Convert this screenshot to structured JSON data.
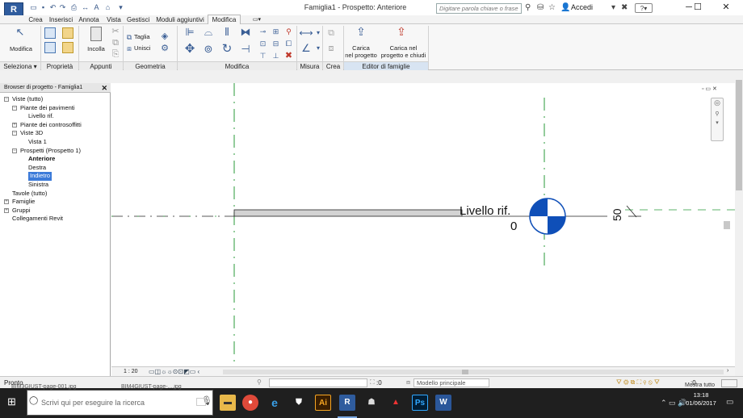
{
  "app": {
    "logo": "R",
    "title": "Famiglia1 - Prospetto: Anteriore"
  },
  "search": {
    "placeholder": "Digitare parola chiave o frase"
  },
  "account": {
    "label": "Accedi"
  },
  "tabs": [
    "Crea",
    "Inserisci",
    "Annota",
    "Vista",
    "Gestisci",
    "Moduli aggiuntivi",
    "Modifica"
  ],
  "active_tab": "Modifica",
  "ribbon": {
    "modifica": "Modifica",
    "incolla": "Incolla",
    "taglia": "Taglia",
    "unisci": "Unisci",
    "carica_progetto_1": "Carica",
    "carica_progetto_2": "nel progetto",
    "carica_chiudi_1": "Carica nel",
    "carica_chiudi_2": "progetto e chiudi",
    "panels": [
      "Seleziona ▾",
      "Proprietà",
      "Appunti",
      "Geometria",
      "Modifica",
      "Misura",
      "Crea",
      "Editor di famiglie"
    ]
  },
  "browser": {
    "title": "Browser di progetto - Famiglia1",
    "close": "✕",
    "tree": [
      {
        "label": "Viste (tutto)",
        "level": 0,
        "exp": "−"
      },
      {
        "label": "Piante dei pavimenti",
        "level": 1,
        "exp": "−"
      },
      {
        "label": "Livello rif.",
        "level": 2
      },
      {
        "label": "Piante dei controsoffitti",
        "level": 1,
        "exp": "+"
      },
      {
        "label": "Viste 3D",
        "level": 1,
        "exp": "−"
      },
      {
        "label": "Vista 1",
        "level": 2
      },
      {
        "label": "Prospetti (Prospetto 1)",
        "level": 1,
        "exp": "−"
      },
      {
        "label": "Anteriore",
        "level": 2,
        "bold": true
      },
      {
        "label": "Destra",
        "level": 2
      },
      {
        "label": "Indietro",
        "level": 2,
        "selected": true
      },
      {
        "label": "Sinistra",
        "level": 2
      },
      {
        "label": "Tavole (tutto)",
        "level": 0
      },
      {
        "label": "Famiglie",
        "level": 0,
        "exp": "+"
      },
      {
        "label": "Gruppi",
        "level": 0,
        "exp": "+"
      },
      {
        "label": "Collegamenti Revit",
        "level": 0
      }
    ]
  },
  "canvas": {
    "level_name": "Livello rif.",
    "level_elevation": "0",
    "dimension": "50"
  },
  "view_control": {
    "scale": "1 : 20"
  },
  "status": {
    "text": "Pronto",
    "filter_count": ":0",
    "model": "Modello principale",
    "filter": ":0"
  },
  "taskbar": {
    "search_placeholder": "Scrivi qui per eseguire la ricerca",
    "time": "13:18",
    "date": "01/06/2017",
    "preview1": "BIM3GIUST-page-001.jpg",
    "preview2": "BIM4GIUST-page-....jpg",
    "preview3": "Mostra tutto"
  },
  "colors": {
    "accent": "#3b7ad9",
    "ribbon": "#f7f7f7",
    "taskbar": "#1f1f1f",
    "level_blue": "#0f4fb8",
    "grid_green": "#2a9a3a"
  }
}
